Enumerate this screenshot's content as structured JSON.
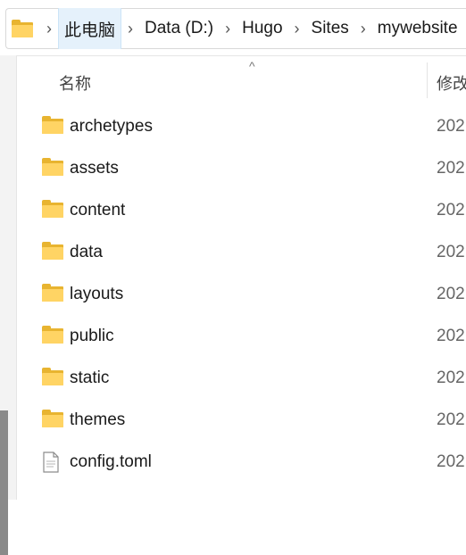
{
  "breadcrumb": {
    "items": [
      {
        "label": "此电脑",
        "active": true
      },
      {
        "label": "Data (D:)",
        "active": false
      },
      {
        "label": "Hugo",
        "active": false
      },
      {
        "label": "Sites",
        "active": false
      },
      {
        "label": "mywebsite",
        "active": false
      }
    ],
    "separator": "›"
  },
  "columns": {
    "sort_indicator": "^",
    "name": "名称",
    "modified": "修改"
  },
  "files": [
    {
      "name": "archetypes",
      "type": "folder",
      "date": "202"
    },
    {
      "name": "assets",
      "type": "folder",
      "date": "202"
    },
    {
      "name": "content",
      "type": "folder",
      "date": "202"
    },
    {
      "name": "data",
      "type": "folder",
      "date": "202"
    },
    {
      "name": "layouts",
      "type": "folder",
      "date": "202"
    },
    {
      "name": "public",
      "type": "folder",
      "date": "202"
    },
    {
      "name": "static",
      "type": "folder",
      "date": "202"
    },
    {
      "name": "themes",
      "type": "folder",
      "date": "202"
    },
    {
      "name": "config.toml",
      "type": "file",
      "date": "202"
    }
  ],
  "colors": {
    "folder_front": "#ffd464",
    "folder_back": "#e8b430",
    "active_crumb_bg": "#e5f1fb"
  }
}
